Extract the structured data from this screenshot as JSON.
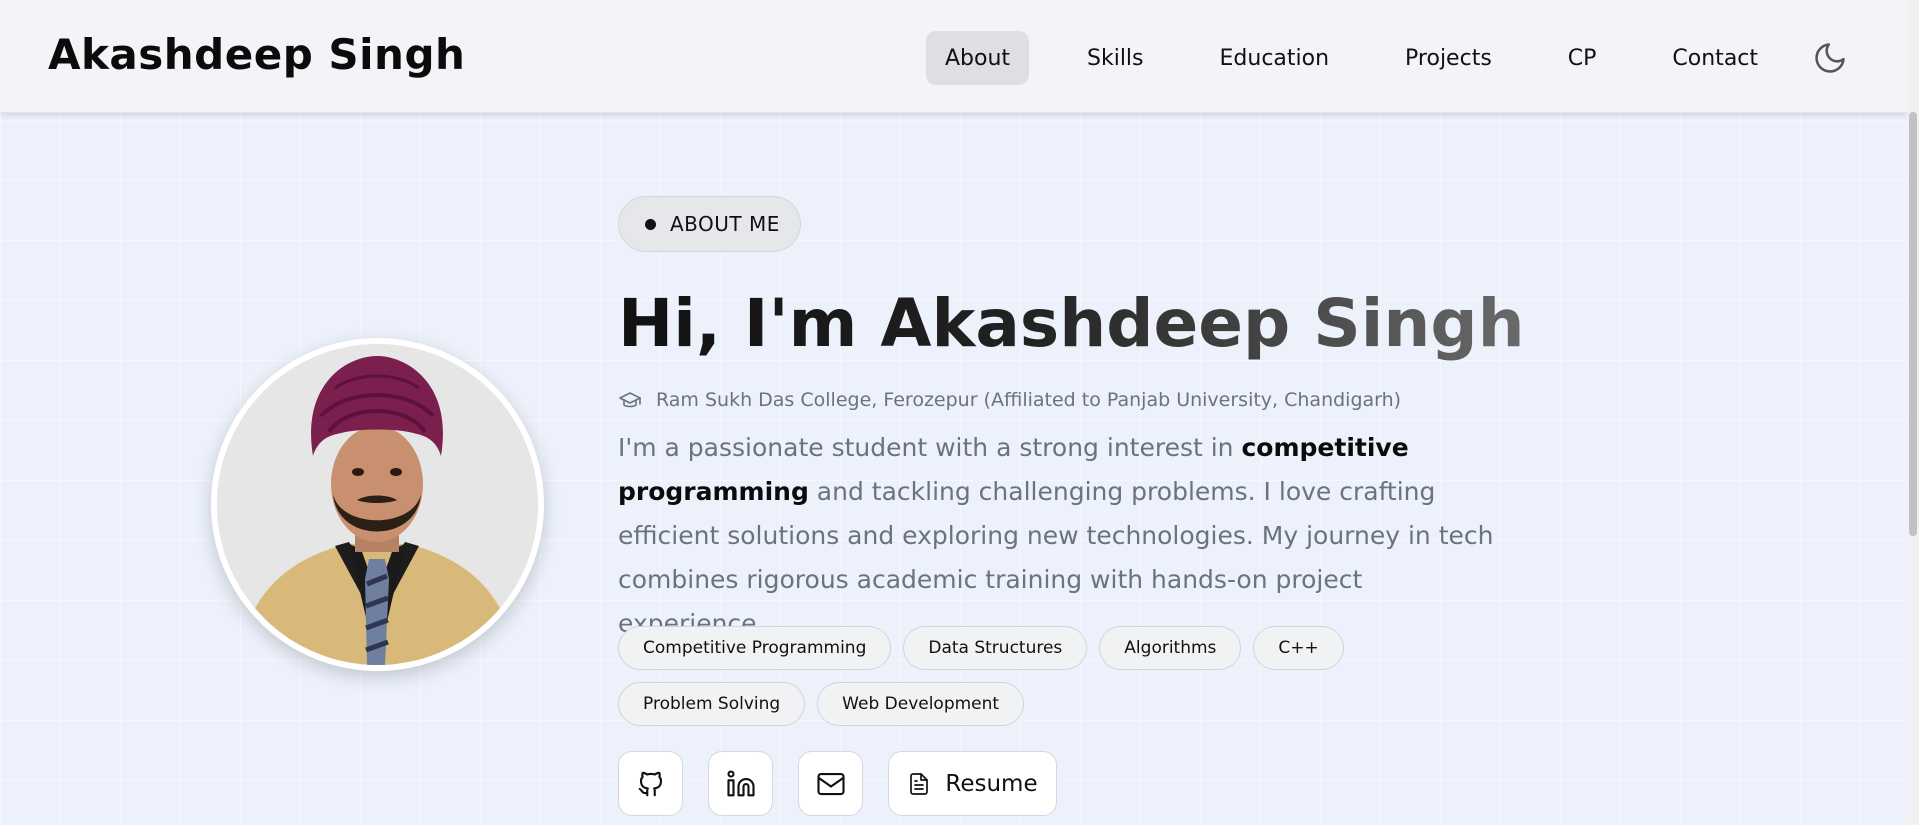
{
  "brand": {
    "name": "Akashdeep Singh"
  },
  "nav": {
    "items": [
      {
        "label": "About",
        "active": true
      },
      {
        "label": "Skills"
      },
      {
        "label": "Education"
      },
      {
        "label": "Projects"
      },
      {
        "label": "CP"
      },
      {
        "label": "Contact"
      }
    ],
    "theme_toggle_icon": "moon-icon"
  },
  "hero": {
    "badge": "ABOUT ME",
    "title": "Hi, I'm Akashdeep Singh",
    "college": "Ram Sukh Das College, Ferozepur (Affiliated to Panjab University, Chandigarh)",
    "bio": {
      "part1": "I'm a passionate student with a strong interest in ",
      "highlight": "competitive programming",
      "part2": " and tackling challenging problems. I love crafting efficient solutions and exploring new technologies. My journey in tech combines rigorous academic training with hands-on project experience."
    },
    "tags": [
      "Competitive Programming",
      "Data Structures",
      "Algorithms",
      "C++",
      "Problem Solving",
      "Web Development"
    ],
    "socials": {
      "github_icon": "github-icon",
      "linkedin_icon": "linkedin-icon",
      "email_icon": "mail-icon",
      "resume_label": "Resume"
    }
  },
  "colors": {
    "background": "#ecf1fb",
    "navbar": "#f3f4f7",
    "active_nav": "#dedfe3",
    "muted_text": "#6b7280",
    "turban": "#7a1f4e",
    "jacket": "#d9b97a"
  }
}
